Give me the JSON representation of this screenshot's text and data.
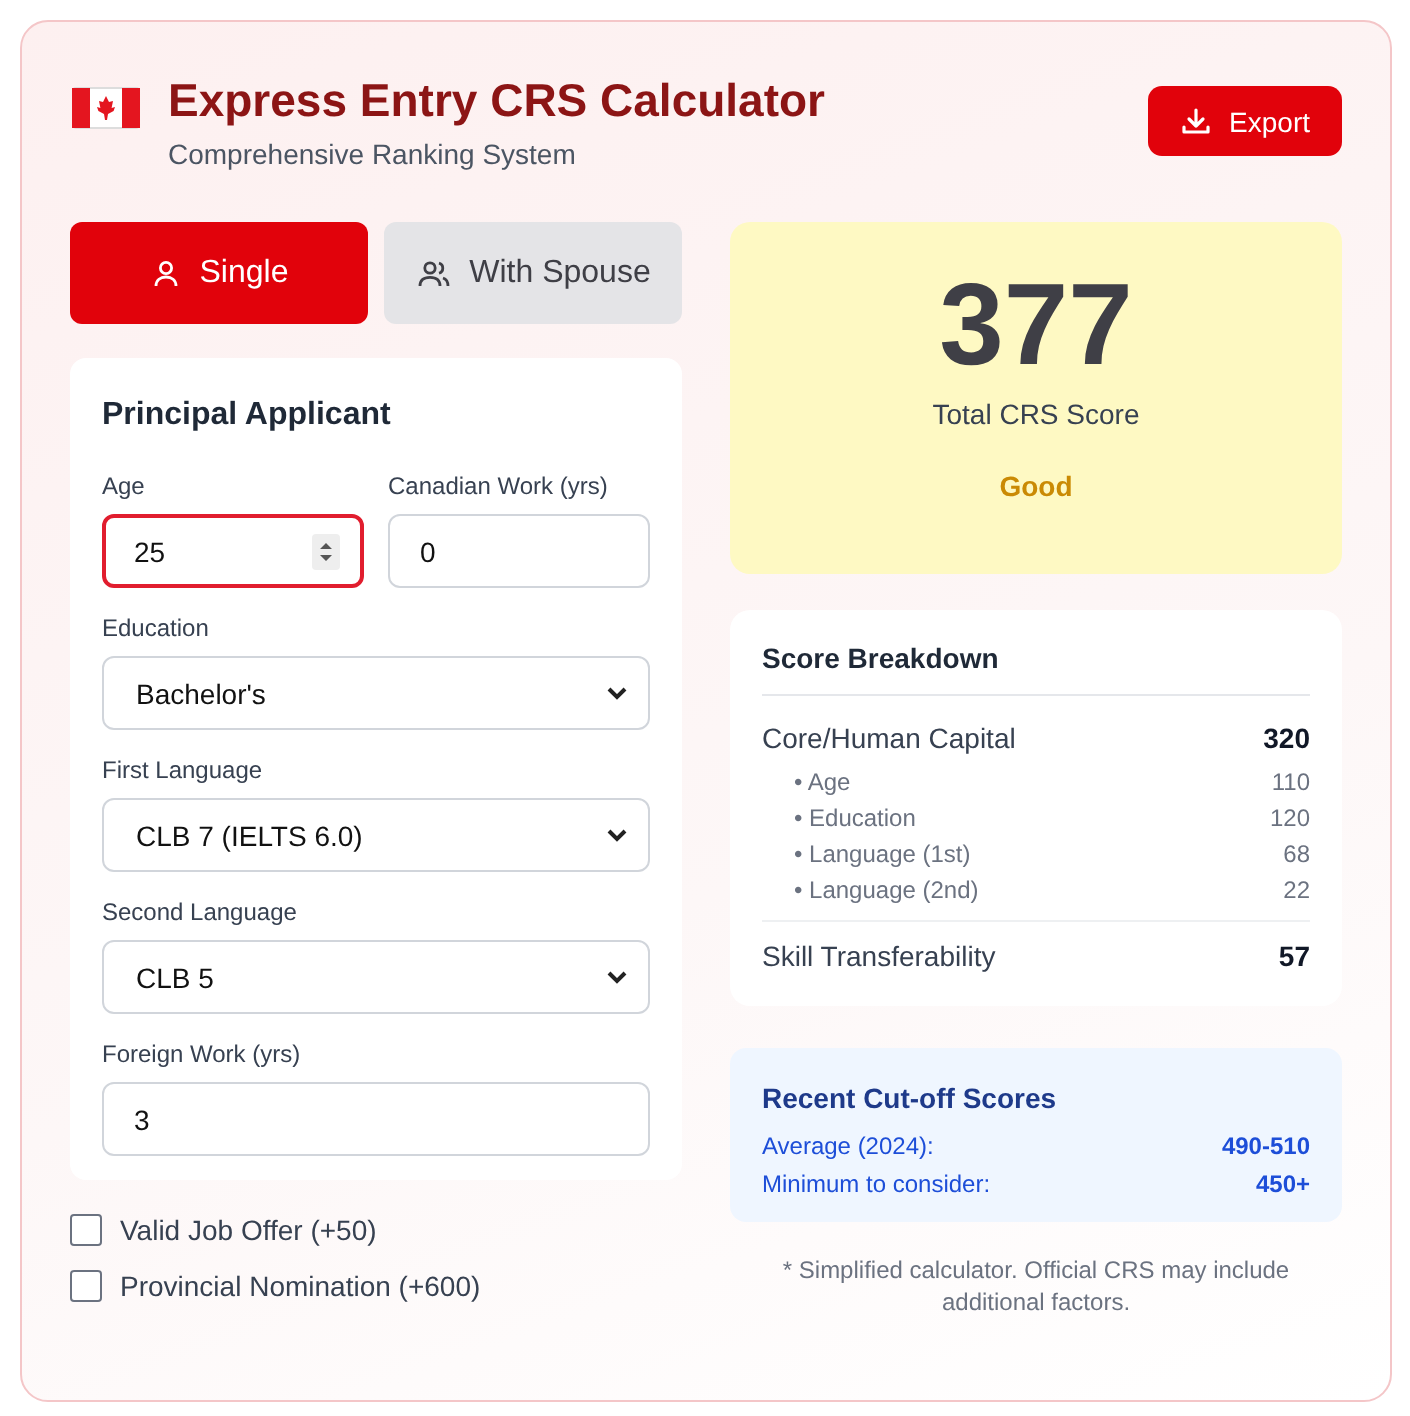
{
  "header": {
    "title": "Express Entry CRS Calculator",
    "subtitle": "Comprehensive Ranking System",
    "export_button": "Export"
  },
  "modes": [
    {
      "label": "Single",
      "kind": "single",
      "selected": true
    },
    {
      "label": "With Spouse",
      "kind": "couple",
      "selected": false
    }
  ],
  "form": {
    "title": "Principal Applicant",
    "fields": [
      {
        "label": "Age",
        "kind": "number",
        "value": "25",
        "focused": true
      },
      {
        "label": "Canadian Work (yrs)",
        "kind": "number",
        "value": "0",
        "focused": false
      },
      {
        "label": "Education",
        "kind": "select",
        "value": "Bachelor's",
        "focused": false
      },
      {
        "label": "First Language",
        "kind": "select",
        "value": "CLB 7 (IELTS 6.0)",
        "focused": false
      },
      {
        "label": "Second Language",
        "kind": "select",
        "value": "CLB 5",
        "focused": false
      },
      {
        "label": "Foreign Work (yrs)",
        "kind": "number",
        "value": "3",
        "focused": false
      }
    ]
  },
  "options": [
    {
      "label": "Valid Job Offer (+50)",
      "checked": false
    },
    {
      "label": "Provincial Nomination (+600)",
      "checked": false
    }
  ],
  "score": {
    "value": "377",
    "label": "Total CRS Score",
    "rating": "Good"
  },
  "breakdown": {
    "title": "Score Breakdown",
    "rows": [
      {
        "kind": "main",
        "label": "Core/Human Capital",
        "value": "320"
      },
      {
        "kind": "sub",
        "label": "• Age",
        "value": "110"
      },
      {
        "kind": "sub",
        "label": "• Education",
        "value": "120"
      },
      {
        "kind": "sub",
        "label": "• Language (1st)",
        "value": "68"
      },
      {
        "kind": "sub",
        "label": "• Language (2nd)",
        "value": "22"
      },
      {
        "kind": "main",
        "label": "Skill Transferability",
        "value": "57"
      }
    ]
  },
  "cutoff": {
    "title": "Recent Cut-off Scores",
    "rows": [
      {
        "label": "Average (2024):",
        "value": "490-510"
      },
      {
        "label": "Minimum to consider:",
        "value": "450+"
      }
    ]
  },
  "footnote": "* Simplified calculator. Official CRS may include additional factors."
}
